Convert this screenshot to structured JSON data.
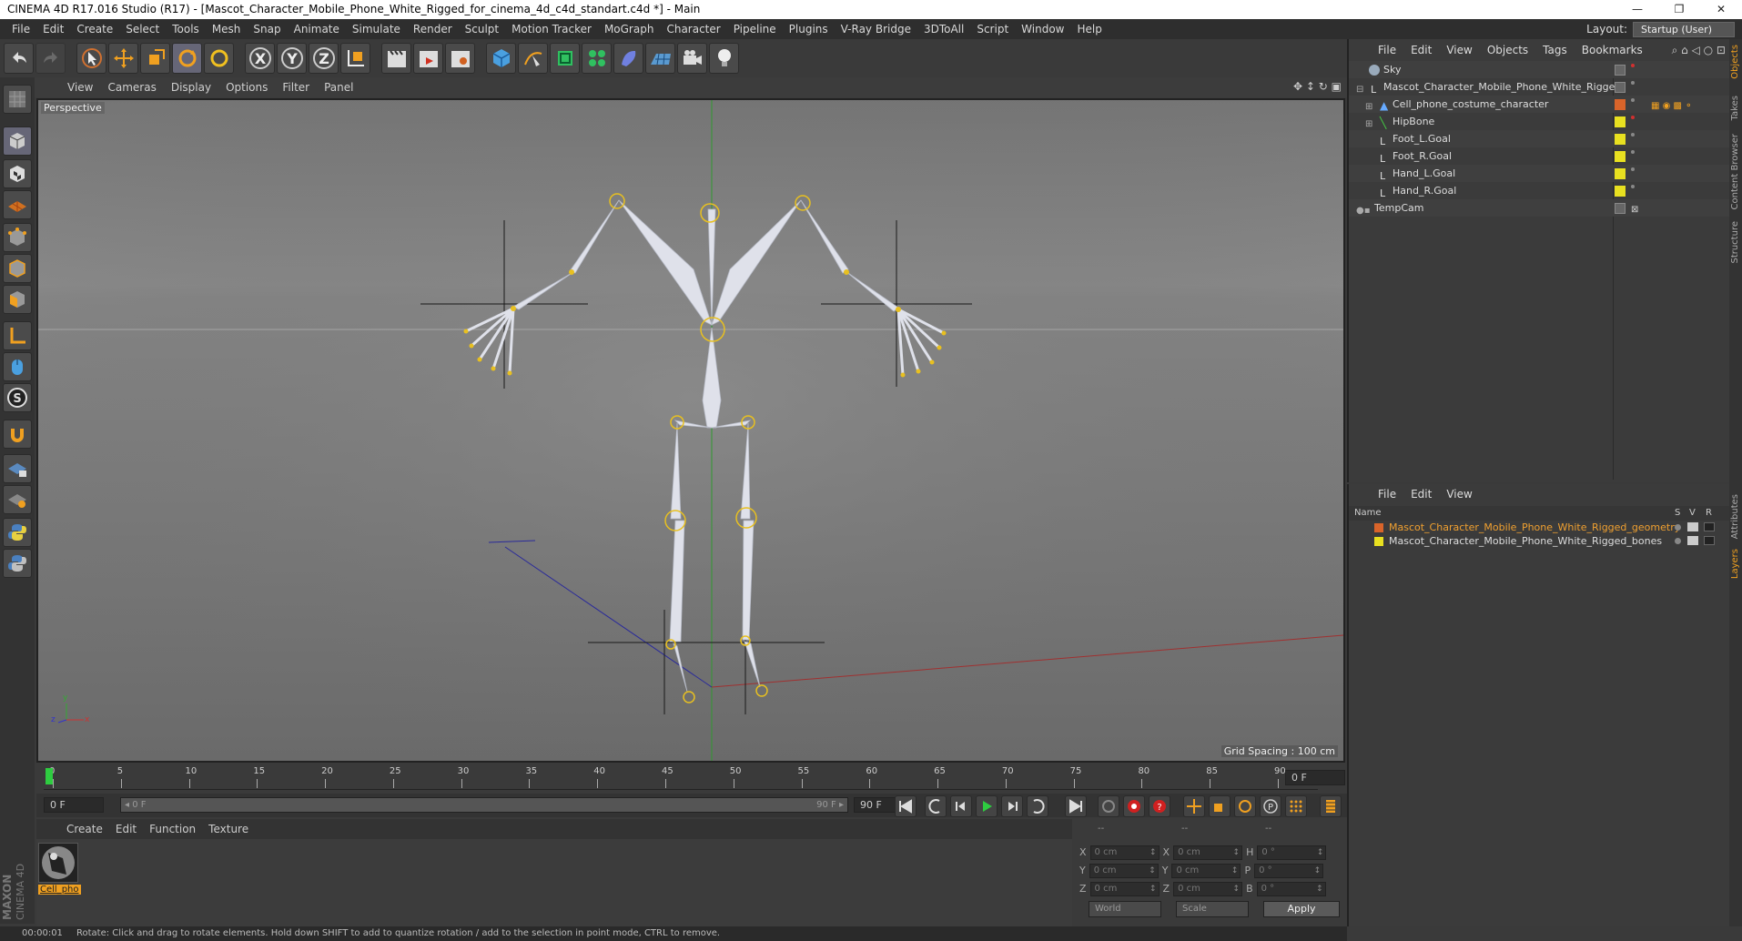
{
  "window": {
    "title": "CINEMA 4D R17.016 Studio (R17) - [Mascot_Character_Mobile_Phone_White_Rigged_for_cinema_4d_c4d_standart.c4d *] - Main",
    "controls": [
      "—",
      "❐",
      "✕"
    ]
  },
  "menubar": {
    "items": [
      "File",
      "Edit",
      "Create",
      "Select",
      "Tools",
      "Mesh",
      "Snap",
      "Animate",
      "Simulate",
      "Render",
      "Sculpt",
      "Motion Tracker",
      "MoGraph",
      "Character",
      "Pipeline",
      "Plugins",
      "V-Ray Bridge",
      "3DToAll",
      "Script",
      "Window",
      "Help"
    ],
    "layout_label": "Layout:",
    "layout_value": "Startup (User)"
  },
  "toolbar": {
    "axis_x": "X",
    "axis_y": "Y",
    "axis_z": "Z"
  },
  "viewport": {
    "menu": [
      "View",
      "Cameras",
      "Display",
      "Options",
      "Filter",
      "Panel"
    ],
    "nav_icons": "✥ ↕ ↻ ▣",
    "label": "Perspective",
    "grid_spacing": "Grid Spacing : 100 cm",
    "axis_y": "y",
    "axis_x": "x",
    "axis_z": "z"
  },
  "timeline": {
    "ticks": [
      "0",
      "5",
      "10",
      "15",
      "20",
      "25",
      "30",
      "35",
      "40",
      "45",
      "50",
      "55",
      "60",
      "65",
      "70",
      "75",
      "80",
      "85",
      "90"
    ],
    "current_frame": "0 F",
    "start": "0 F",
    "slider_start": "◂ 0 F",
    "slider_end": "90 F ▸",
    "end": "90 F"
  },
  "materials": {
    "menu": [
      "Create",
      "Edit",
      "Function",
      "Texture"
    ],
    "item_label": "Cell_pho"
  },
  "coords": {
    "headers": [
      "--",
      "--",
      "--"
    ],
    "rows": [
      {
        "a": "X",
        "av": "0 cm",
        "b": "X",
        "bv": "0 cm",
        "c": "H",
        "cv": "0 °"
      },
      {
        "a": "Y",
        "av": "0 cm",
        "b": "Y",
        "bv": "0 cm",
        "c": "P",
        "cv": "0 °"
      },
      {
        "a": "Z",
        "av": "0 cm",
        "b": "Z",
        "bv": "0 cm",
        "c": "B",
        "cv": "0 °"
      }
    ],
    "world": "World",
    "scale": "Scale",
    "apply": "Apply"
  },
  "status": {
    "time": "00:00:01",
    "message": "Rotate: Click and drag to rotate elements. Hold down SHIFT to add to quantize rotation / add to the selection in point mode, CTRL to remove."
  },
  "objects": {
    "menu": [
      "File",
      "Edit",
      "View",
      "Objects",
      "Tags",
      "Bookmarks"
    ],
    "rows": [
      {
        "name": "Sky",
        "indent": 0,
        "color": "#888"
      },
      {
        "name": "Mascot_Character_Mobile_Phone_White_Rigged",
        "indent": 0,
        "color": "#888"
      },
      {
        "name": "Cell_phone_costume_character",
        "indent": 1,
        "color": "#d9642a"
      },
      {
        "name": "HipBone",
        "indent": 1,
        "color": "#e8e020"
      },
      {
        "name": "Foot_L.Goal",
        "indent": 2,
        "color": "#e8e020"
      },
      {
        "name": "Foot_R.Goal",
        "indent": 2,
        "color": "#e8e020"
      },
      {
        "name": "Hand_L.Goal",
        "indent": 2,
        "color": "#e8e020"
      },
      {
        "name": "Hand_R.Goal",
        "indent": 2,
        "color": "#e8e020"
      },
      {
        "name": "TempCam",
        "indent": 0,
        "color": "#888"
      }
    ]
  },
  "layers": {
    "menu": [
      "File",
      "Edit",
      "View"
    ],
    "header_name": "Name",
    "header_cols": [
      "S",
      "V",
      "R"
    ],
    "rows": [
      {
        "name": "Mascot_Character_Mobile_Phone_White_Rigged_geometry",
        "color": "#d9642a",
        "text_color": "#f0a030"
      },
      {
        "name": "Mascot_Character_Mobile_Phone_White_Rigged_bones",
        "color": "#e8e020",
        "text_color": "#dddddd"
      }
    ]
  },
  "sidetabs": [
    "Objects",
    "Takes",
    "Content Browser",
    "Structure",
    "Attributes",
    "Layers"
  ],
  "brand": {
    "maxon": "MAXON",
    "product": "CINEMA 4D"
  }
}
